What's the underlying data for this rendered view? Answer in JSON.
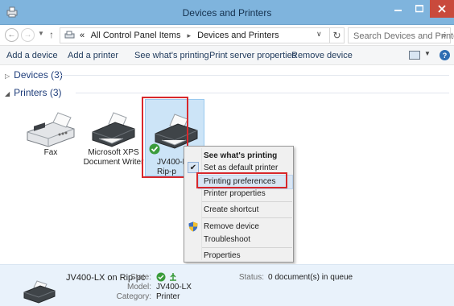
{
  "window": {
    "title": "Devices and Printers"
  },
  "address": {
    "crumbs": [
      "«",
      "All Control Panel Items",
      "Devices and Printers"
    ],
    "search_placeholder": "Search Devices and Printers"
  },
  "commands": [
    "Add a device",
    "Add a printer",
    "See what's printing",
    "Print server properties",
    "Remove device"
  ],
  "groups": {
    "devices": "Devices (3)",
    "printers": "Printers (3)"
  },
  "printers": [
    {
      "label": "Fax"
    },
    {
      "label": "Microsoft XPS Document Writer"
    },
    {
      "label": "JV400-LX on Rip-pc",
      "label_visible": "JV400-L\nRip-p"
    }
  ],
  "context_menu": {
    "items": [
      {
        "label": "See what's printing",
        "bold": true
      },
      {
        "label": "Set as default printer",
        "checked": true
      },
      {
        "label": "Printing preferences",
        "highlighted": true
      },
      {
        "label": "Printer properties"
      },
      {
        "label": "Create shortcut"
      },
      {
        "label": "Remove device",
        "icon": "shield-icon"
      },
      {
        "label": "Troubleshoot"
      },
      {
        "label": "Properties"
      }
    ]
  },
  "details": {
    "name": "JV400-LX on Rip-pc",
    "state_label": "State:",
    "model_label": "Model:",
    "model": "JV400-LX",
    "category_label": "Category:",
    "category": "Printer",
    "status_label": "Status:",
    "status": "0 document(s) in queue"
  },
  "colors": {
    "titlebar": "#7fb4dd",
    "close": "#c94a3c",
    "selection": "#cce4f7",
    "callout": "#d8282c"
  }
}
